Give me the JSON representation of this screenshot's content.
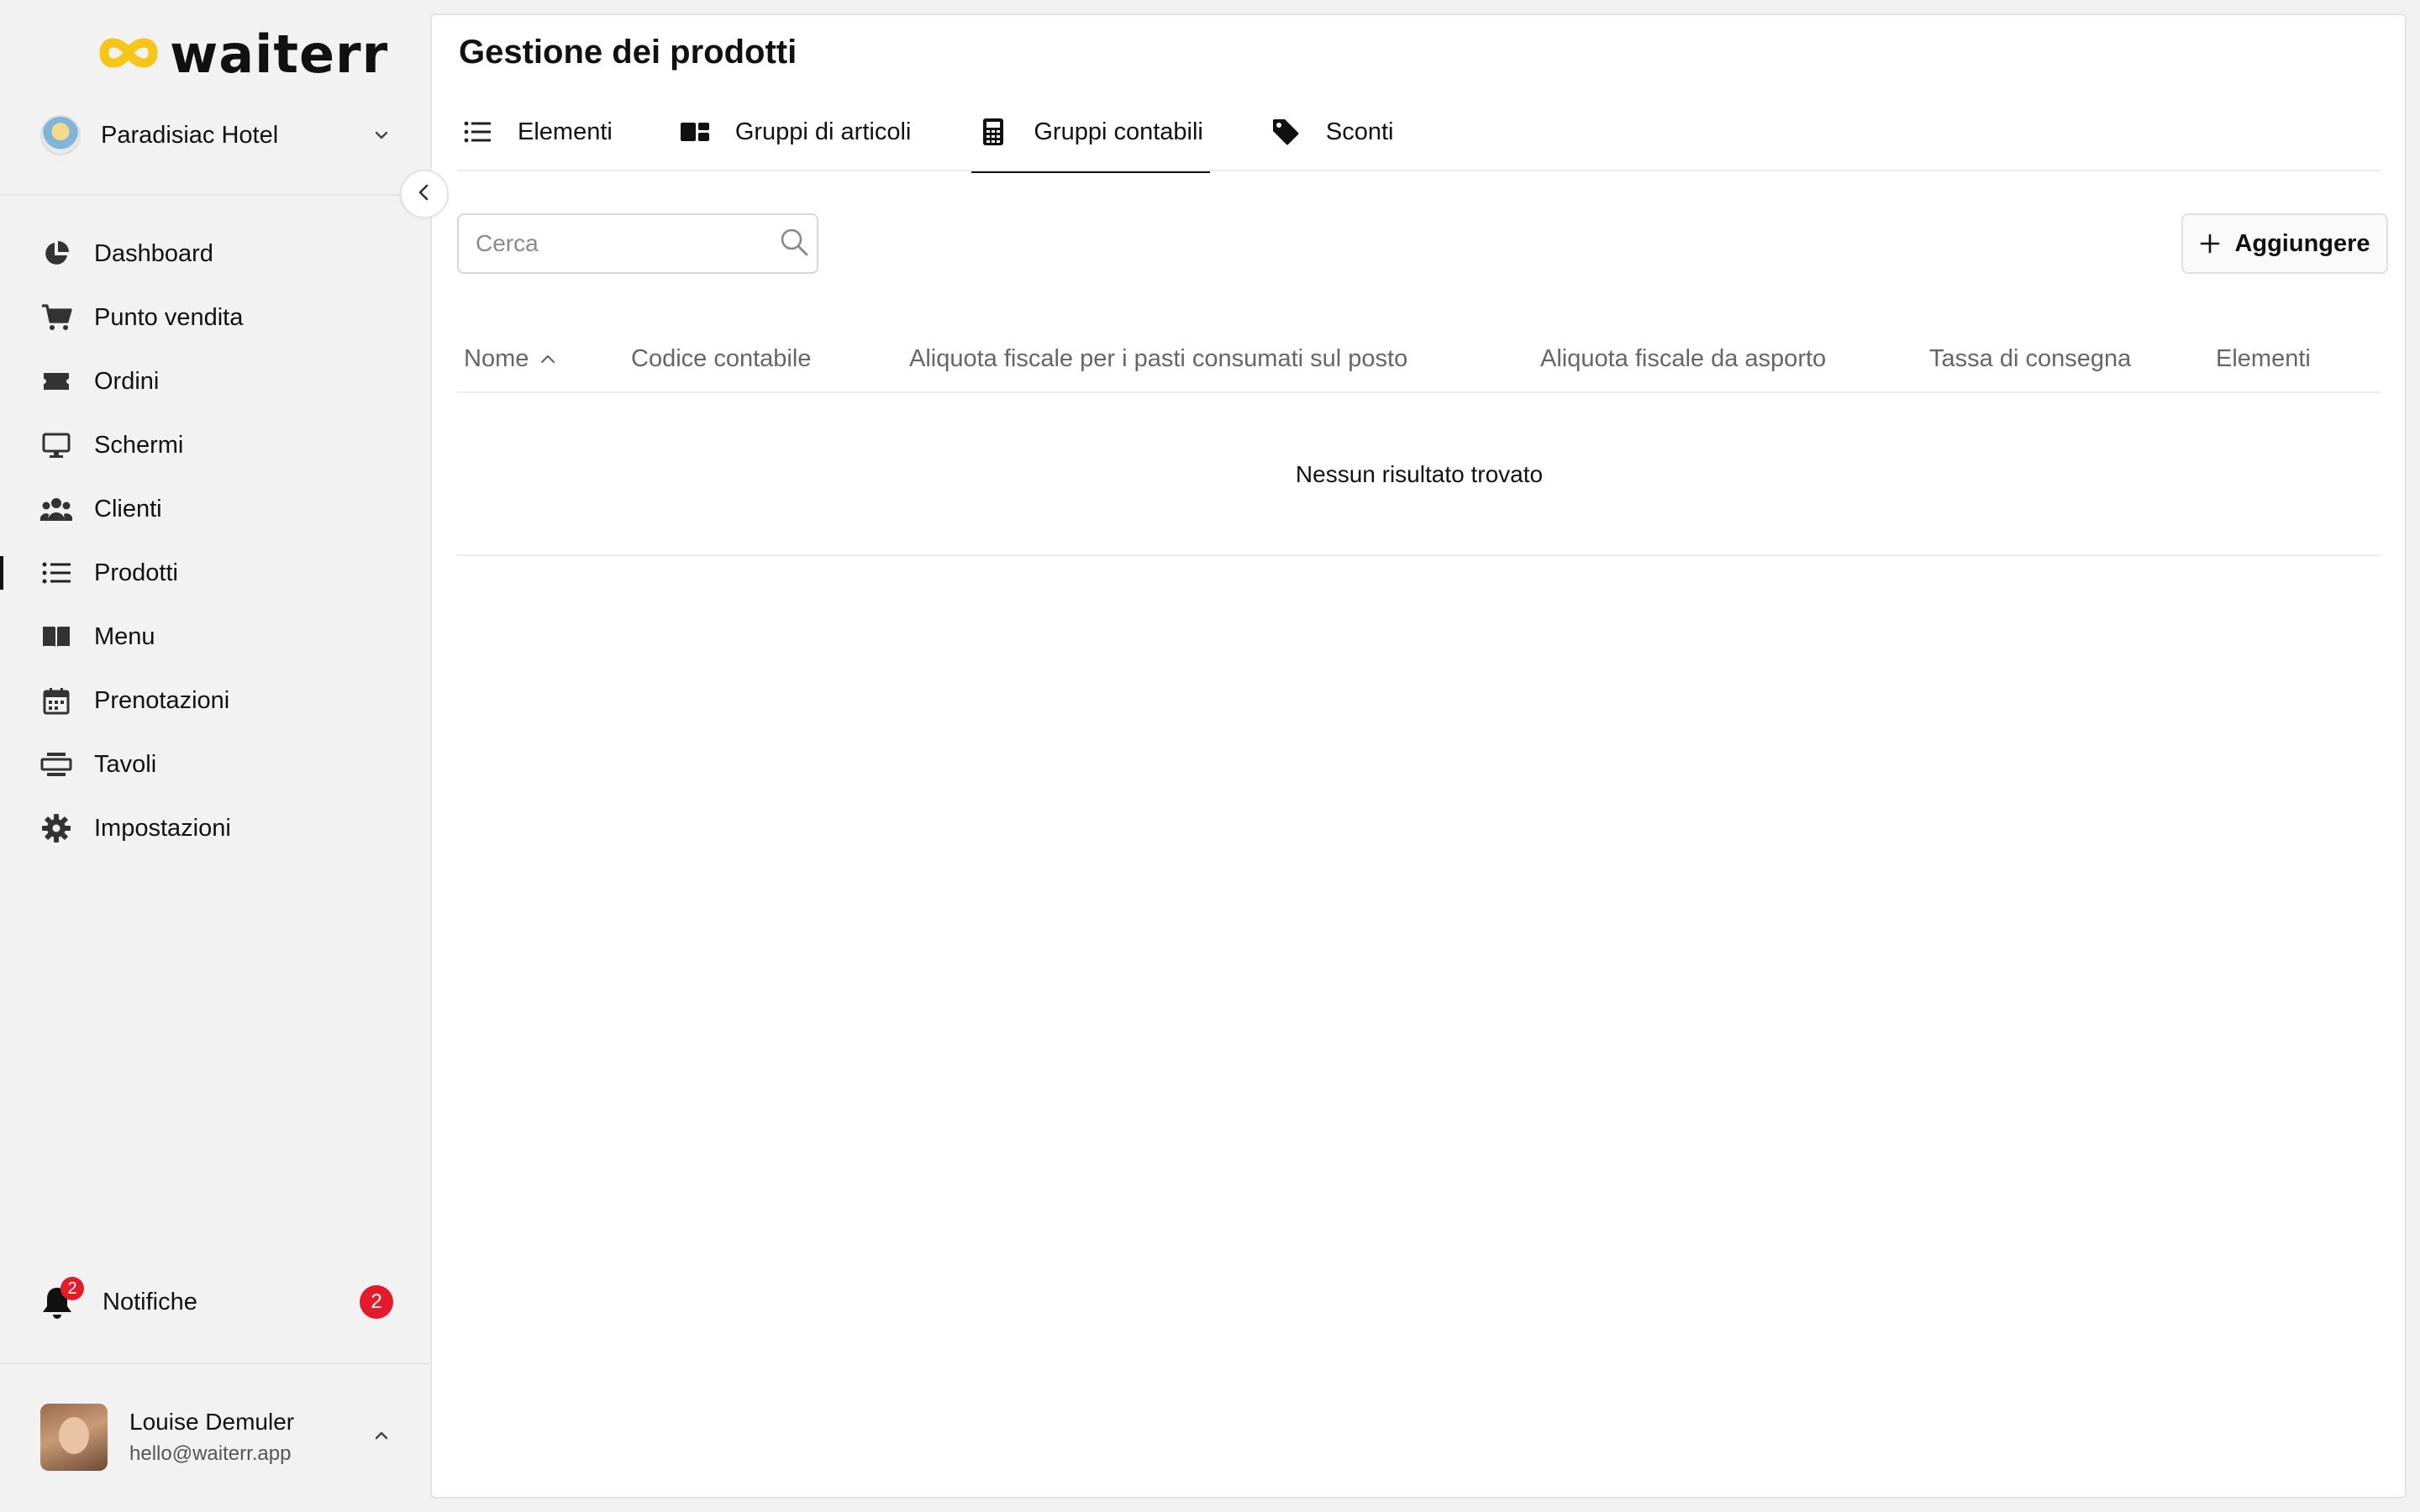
{
  "brand": {
    "name": "waiterr",
    "accent": "#f5c518"
  },
  "venue": {
    "name": "Paradisiac Hotel"
  },
  "sidebar": {
    "items": [
      {
        "label": "Dashboard",
        "icon": "pie-chart-icon"
      },
      {
        "label": "Punto vendita",
        "icon": "cart-icon"
      },
      {
        "label": "Ordini",
        "icon": "ticket-icon"
      },
      {
        "label": "Schermi",
        "icon": "monitor-icon"
      },
      {
        "label": "Clienti",
        "icon": "users-icon"
      },
      {
        "label": "Prodotti",
        "icon": "list-icon",
        "active": true
      },
      {
        "label": "Menu",
        "icon": "book-icon"
      },
      {
        "label": "Prenotazioni",
        "icon": "calendar-icon"
      },
      {
        "label": "Tavoli",
        "icon": "table-icon"
      },
      {
        "label": "Impostazioni",
        "icon": "gear-icon"
      }
    ]
  },
  "notifications": {
    "label": "Notifiche",
    "bell_count": "2",
    "count": "2",
    "badge_color": "#e31b2a"
  },
  "user": {
    "name": "Louise Demuler",
    "email": "hello@waiterr.app"
  },
  "page": {
    "title": "Gestione dei prodotti",
    "tabs": [
      {
        "label": "Elementi",
        "icon": "list-icon"
      },
      {
        "label": "Gruppi di articoli",
        "icon": "groups-icon"
      },
      {
        "label": "Gruppi contabili",
        "icon": "calculator-icon",
        "active": true
      },
      {
        "label": "Sconti",
        "icon": "tag-icon"
      }
    ],
    "search": {
      "placeholder": "Cerca",
      "value": ""
    },
    "add_label": "Aggiungere",
    "table": {
      "columns": [
        "Nome",
        "Codice contabile",
        "Aliquota fiscale per i pasti consumati sul posto",
        "Aliquota fiscale da asporto",
        "Tassa di consegna",
        "Elementi"
      ],
      "sorted_column": "Nome",
      "sort_direction": "asc",
      "empty_message": "Nessun risultato trovato"
    }
  }
}
